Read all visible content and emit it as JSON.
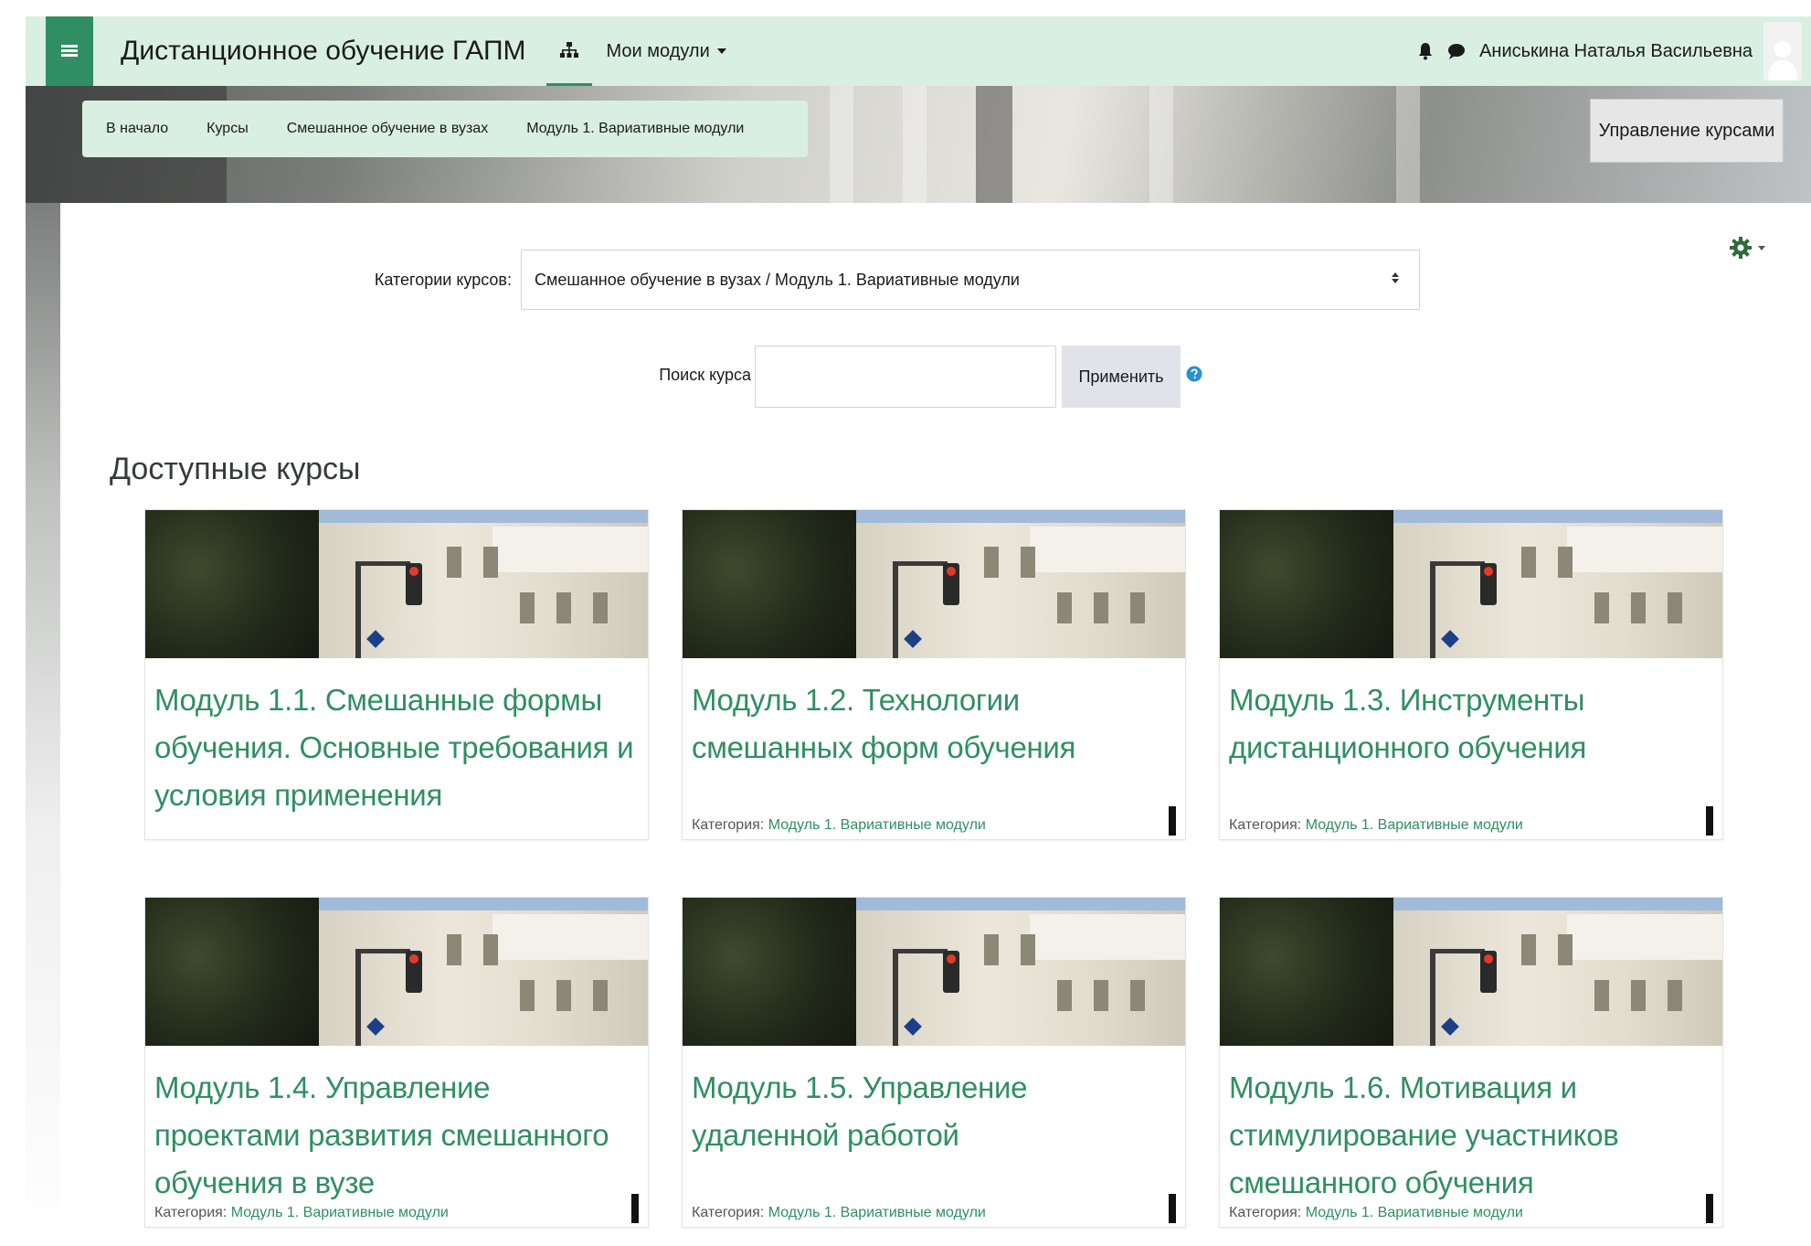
{
  "navbar": {
    "site_name": "Дистанционное обучение ГАПМ",
    "my_modules": "Мои модули",
    "user_name": "Аниськина Наталья Васильевна"
  },
  "breadcrumb": {
    "items": [
      "В начало",
      "Курсы",
      "Смешанное обучение в вузах",
      "Модуль 1. Вариативные модули"
    ]
  },
  "header": {
    "manage_courses": "Управление курсами"
  },
  "filters": {
    "category_label": "Категории курсов:",
    "category_selected": "Смешанное обучение в вузах / Модуль 1. Вариативные модули",
    "search_label": "Поиск курса",
    "search_value": "",
    "apply_label": "Применить"
  },
  "courses": {
    "title": "Доступные курсы",
    "category_prefix": "Категория:",
    "items": [
      {
        "title": "Модуль 1.1. Смешанные формы обучения. Основные требования и условия применения",
        "category": ""
      },
      {
        "title": "Модуль 1.2. Технологии смешанных форм обучения",
        "category": "Модуль 1. Вариативные модули"
      },
      {
        "title": "Модуль 1.3. Инструменты дистанционного обучения",
        "category": "Модуль 1. Вариативные модули"
      },
      {
        "title": "Модуль 1.4. Управление проектами развития смешанного обучения в вузе",
        "category": "Модуль 1. Вариативные модули"
      },
      {
        "title": "Модуль 1.5. Управление удаленной работой",
        "category": "Модуль 1. Вариативные модули"
      },
      {
        "title": "Модуль 1.6. Мотивация и стимулирование участников смешанного обучения",
        "category": "Модуль 1. Вариативные модули"
      }
    ]
  },
  "icons": {
    "menu": "hamburger-icon",
    "sitemap": "sitemap-icon",
    "notifications": "bell-icon",
    "messages": "chat-icon",
    "settings": "gear-icon",
    "help": "question-circle-icon"
  },
  "colors": {
    "accent": "#2f8f62",
    "navbar_bg": "#d9efe2"
  }
}
